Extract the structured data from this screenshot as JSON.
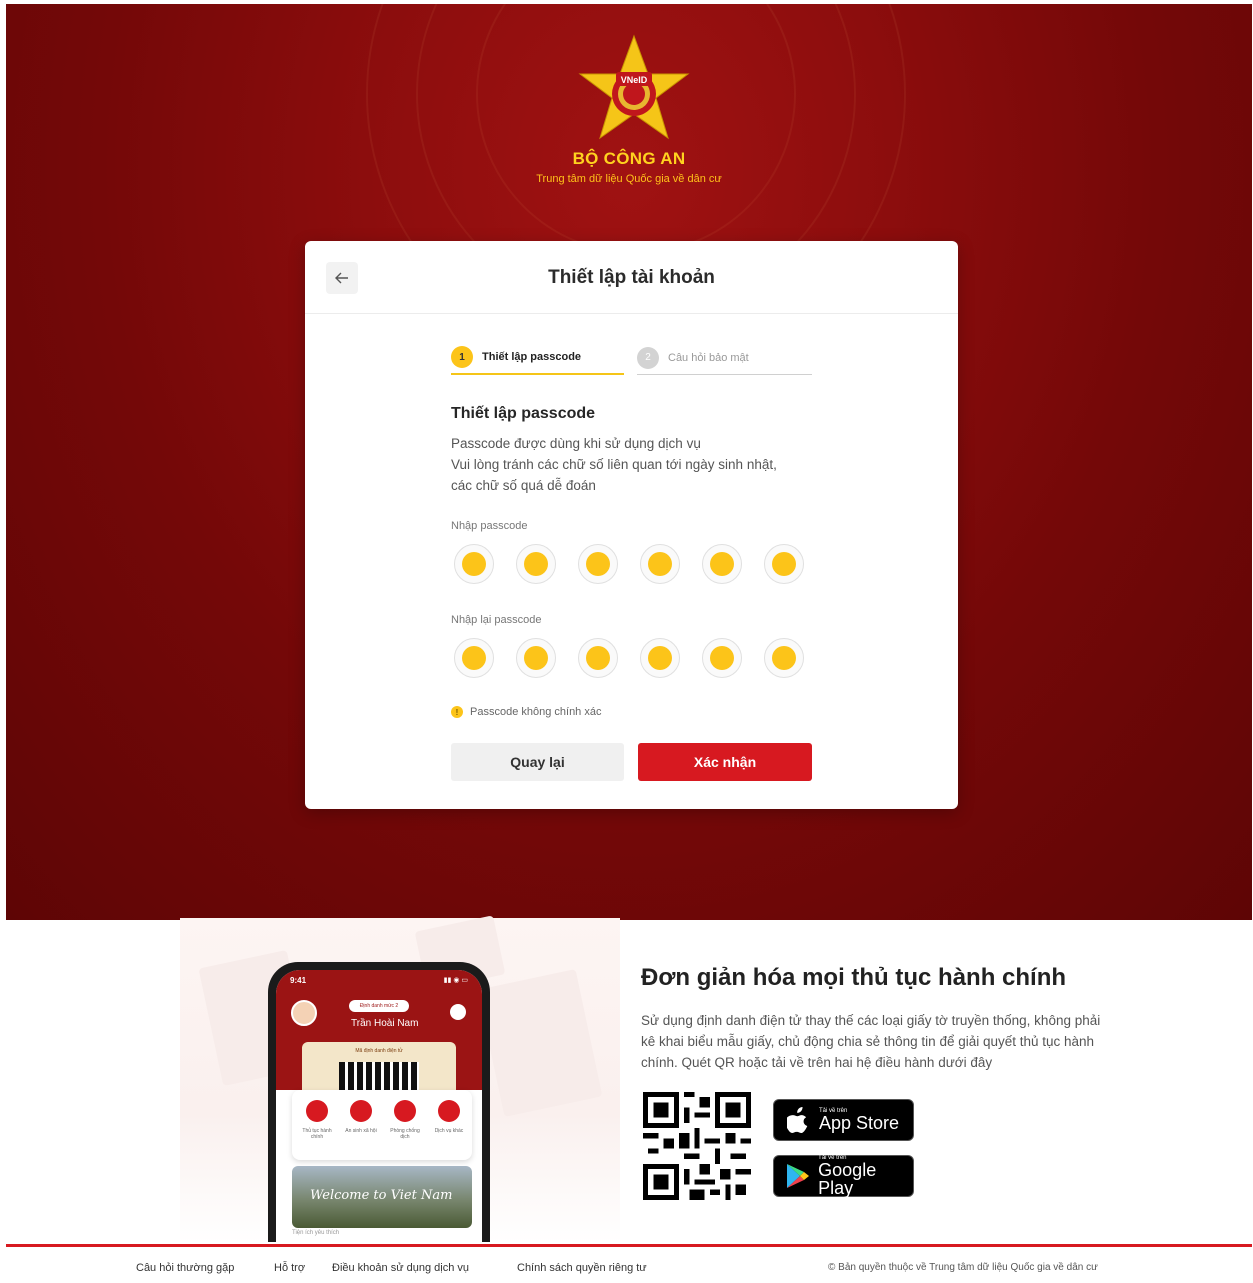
{
  "header": {
    "logo_text": "VNeID",
    "org_name": "BỘ CÔNG AN",
    "org_subtitle": "Trung tâm dữ liệu Quốc gia về dân cư"
  },
  "card": {
    "title": "Thiết lập tài khoản",
    "steps": [
      {
        "number": "1",
        "label": "Thiết lập passcode",
        "active": true
      },
      {
        "number": "2",
        "label": "Câu hỏi bảo mật",
        "active": false
      }
    ],
    "section_title": "Thiết lập passcode",
    "description_lines": [
      "Passcode được dùng khi sử dụng dịch vụ",
      "Vui lòng tránh các chữ số liên quan tới ngày sinh nhật,",
      "các chữ số quá dễ đoán"
    ],
    "passcode_label": "Nhập passcode",
    "repeat_label": "Nhập lại passcode",
    "digits_filled": 6,
    "error_icon": "!",
    "error_text": "Passcode không chính xác",
    "back_button": "Quay lại",
    "confirm_button": "Xác nhận"
  },
  "promo": {
    "title": "Đơn giản hóa mọi thủ tục hành chính",
    "description": "Sử dụng định danh điện tử thay thế các loại giấy tờ truyền thống, không phải kê khai biểu mẫu giấy, chủ động chia sẻ thông tin để giải quyết thủ tục hành chính. Quét QR hoặc tải về trên hai hệ điều hành dưới đây",
    "app_store": {
      "small": "Tải về trên",
      "big": "App Store"
    },
    "google_play": {
      "small": "Tải về trên",
      "big": "Google Play"
    },
    "phone": {
      "time": "9:41",
      "id_level": "Định danh mức 2",
      "user_name": "Trần Hoài Nam",
      "qr_label": "Mã định danh điện tử",
      "menu": [
        "Thủ tục hành chính",
        "An sinh xã hội",
        "Phòng chống dịch",
        "Dịch vụ khác"
      ],
      "banner": "Welcome to Viet Nam",
      "footer": "Tiện ích yêu thích"
    }
  },
  "footer": {
    "links": [
      "Câu hỏi thường gặp",
      "Hỗ trợ",
      "Điều khoản sử dụng dịch vụ",
      "Chính sách quyền riêng tư"
    ],
    "copyright": "© Bản quyền thuộc về Trung tâm dữ liệu Quốc gia về dân cư"
  },
  "colors": {
    "brand_red": "#d71920",
    "hero_red": "#8c0d0d",
    "accent_yellow": "#fcc419",
    "text_dark": "#222222"
  }
}
